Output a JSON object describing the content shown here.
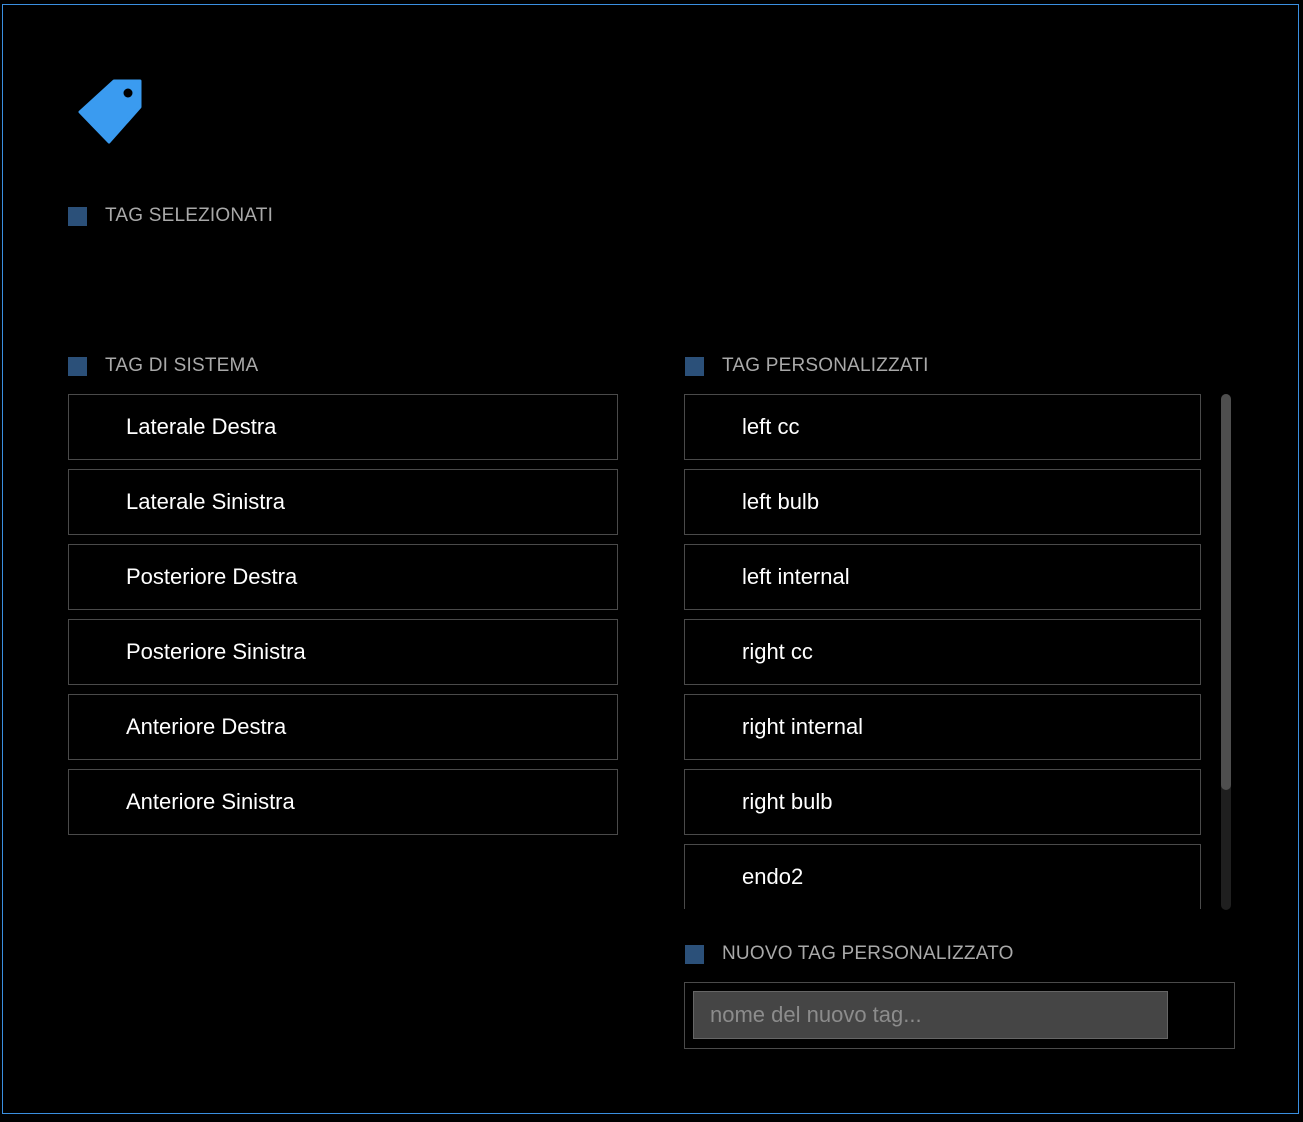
{
  "colors": {
    "accent": "#3a9bf0",
    "frame": "#3a8fe0",
    "section_marker": "#2b5079",
    "background": "#000000"
  },
  "logo": {
    "icon": "price-tag-icon"
  },
  "sections": {
    "selected": {
      "label": "TAG SELEZIONATI"
    },
    "system": {
      "label": "TAG DI SISTEMA"
    },
    "custom": {
      "label": "TAG PERSONALIZZATI"
    },
    "new_tag": {
      "label": "NUOVO TAG PERSONALIZZATO"
    }
  },
  "system_tags": [
    {
      "label": "Laterale Destra"
    },
    {
      "label": "Laterale Sinistra"
    },
    {
      "label": "Posteriore Destra"
    },
    {
      "label": "Posteriore Sinistra"
    },
    {
      "label": "Anteriore Destra"
    },
    {
      "label": "Anteriore Sinistra"
    }
  ],
  "custom_tags": [
    {
      "label": "left cc"
    },
    {
      "label": "left bulb"
    },
    {
      "label": "left internal"
    },
    {
      "label": "right cc"
    },
    {
      "label": "right internal"
    },
    {
      "label": "right bulb"
    },
    {
      "label": "endo2"
    }
  ],
  "new_tag_input": {
    "placeholder": "nome del nuovo tag...",
    "value": ""
  }
}
